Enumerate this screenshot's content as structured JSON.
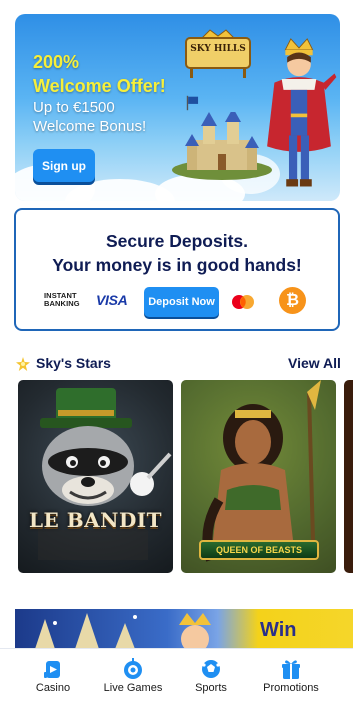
{
  "hero": {
    "line1": "200%",
    "line2": "Welcome Offer!",
    "line3": "Up to €1500",
    "line4": "Welcome Bonus!",
    "signup_label": "Sign up",
    "logo_text": "SKY HILLS"
  },
  "deposit": {
    "title": "Secure Deposits.",
    "subtitle": "Your money is in good hands!",
    "instant_banking": "INSTANT BANKING",
    "visa": "VISA",
    "button_label": "Deposit Now",
    "bitcoin_symbol": "₿"
  },
  "stars": {
    "title": "Sky's Stars",
    "view_all": "View All",
    "games": [
      {
        "title": "LE BANDIT"
      },
      {
        "title": "QUEEN OF BEASTS"
      }
    ]
  },
  "banner": {
    "win_text": "Win"
  },
  "nav": {
    "items": [
      {
        "label": "Casino",
        "icon": "casino-icon"
      },
      {
        "label": "Live Games",
        "icon": "live-games-icon"
      },
      {
        "label": "Sports",
        "icon": "sports-icon"
      },
      {
        "label": "Promotions",
        "icon": "gift-icon"
      }
    ]
  },
  "colors": {
    "primary_button": "#1f8ff2",
    "navy_text": "#0f1c54",
    "card_border": "#1f66b8",
    "nav_icon": "#1f8ff2",
    "bitcoin": "#f7931a"
  }
}
